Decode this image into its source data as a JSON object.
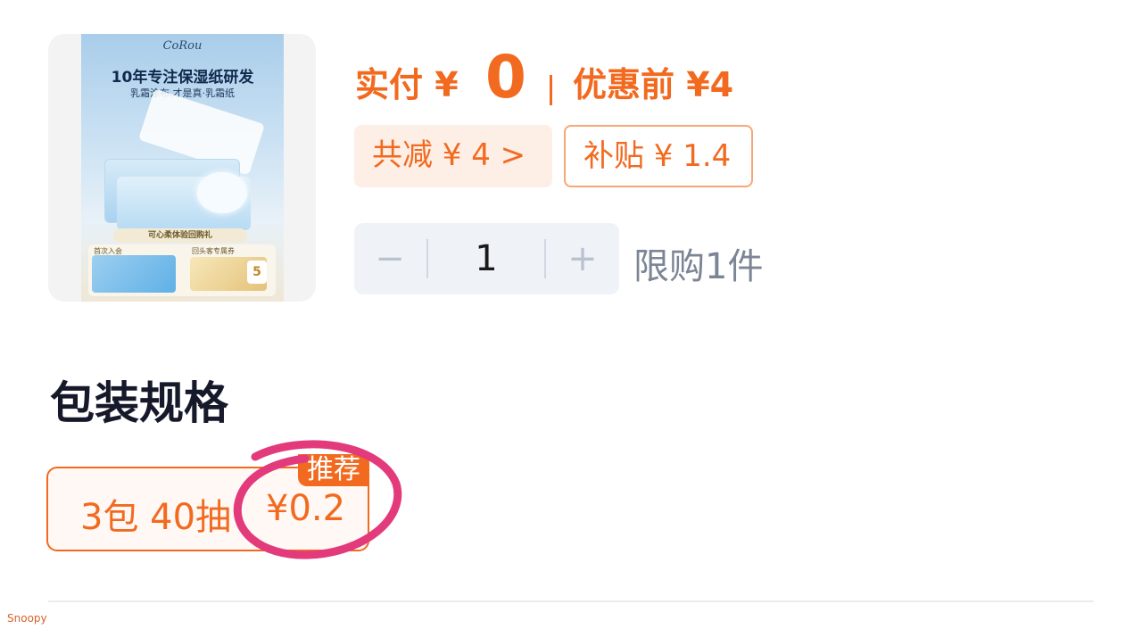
{
  "product": {
    "image": {
      "brand": "CoRou",
      "headline": "10年专注保湿纸研发",
      "subline": "乳霜涂布,才是真·乳霜纸",
      "gift_strip": "可心柔体验回购礼",
      "gift_left_label": "首次入会",
      "gift_right_label": "回头客专属券",
      "gift_badge": "5"
    }
  },
  "price": {
    "pay_label": "实付 ¥",
    "pay_value": "0",
    "before_label": "优惠前 ¥4"
  },
  "chips": {
    "discount": "共减 ¥ 4 >",
    "subsidy": "补贴 ¥ 1.4"
  },
  "stepper": {
    "minus": "−",
    "quantity": "1",
    "plus": "+",
    "limit": "限购1件"
  },
  "spec": {
    "title": "包装规格",
    "option_name": "3包 40抽",
    "option_price": "¥0.2",
    "recommend_tag": "推荐"
  },
  "watermark": "Snoopy",
  "colors": {
    "accent": "#f26a1f",
    "annotation": "#e23a7a"
  }
}
